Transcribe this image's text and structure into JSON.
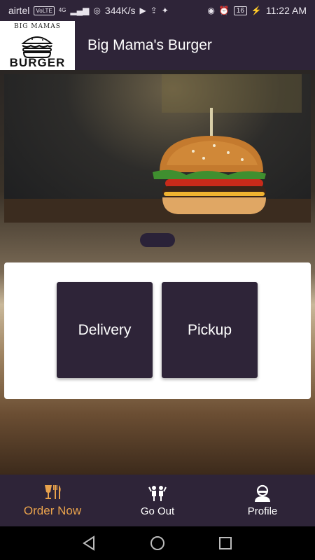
{
  "status_bar": {
    "carrier": "airtel",
    "volte": "VoLTE",
    "network": "4G",
    "speed": "344K/s",
    "battery": "16",
    "time": "11:22 AM"
  },
  "app_bar": {
    "logo_top": "BIG MAMAS",
    "logo_bottom": "BURGER",
    "title": "Big Mama's Burger"
  },
  "order_options": {
    "delivery_label": "Delivery",
    "pickup_label": "Pickup"
  },
  "bottom_nav": {
    "items": [
      {
        "label": "Order Now",
        "icon": "food-cutlery-icon",
        "active": true
      },
      {
        "label": "Go Out",
        "icon": "people-celebrate-icon",
        "active": false
      },
      {
        "label": "Profile",
        "icon": "user-profile-icon",
        "active": false
      }
    ]
  },
  "colors": {
    "primary": "#2e2438",
    "accent": "#e8a24c",
    "card": "#ffffff"
  }
}
